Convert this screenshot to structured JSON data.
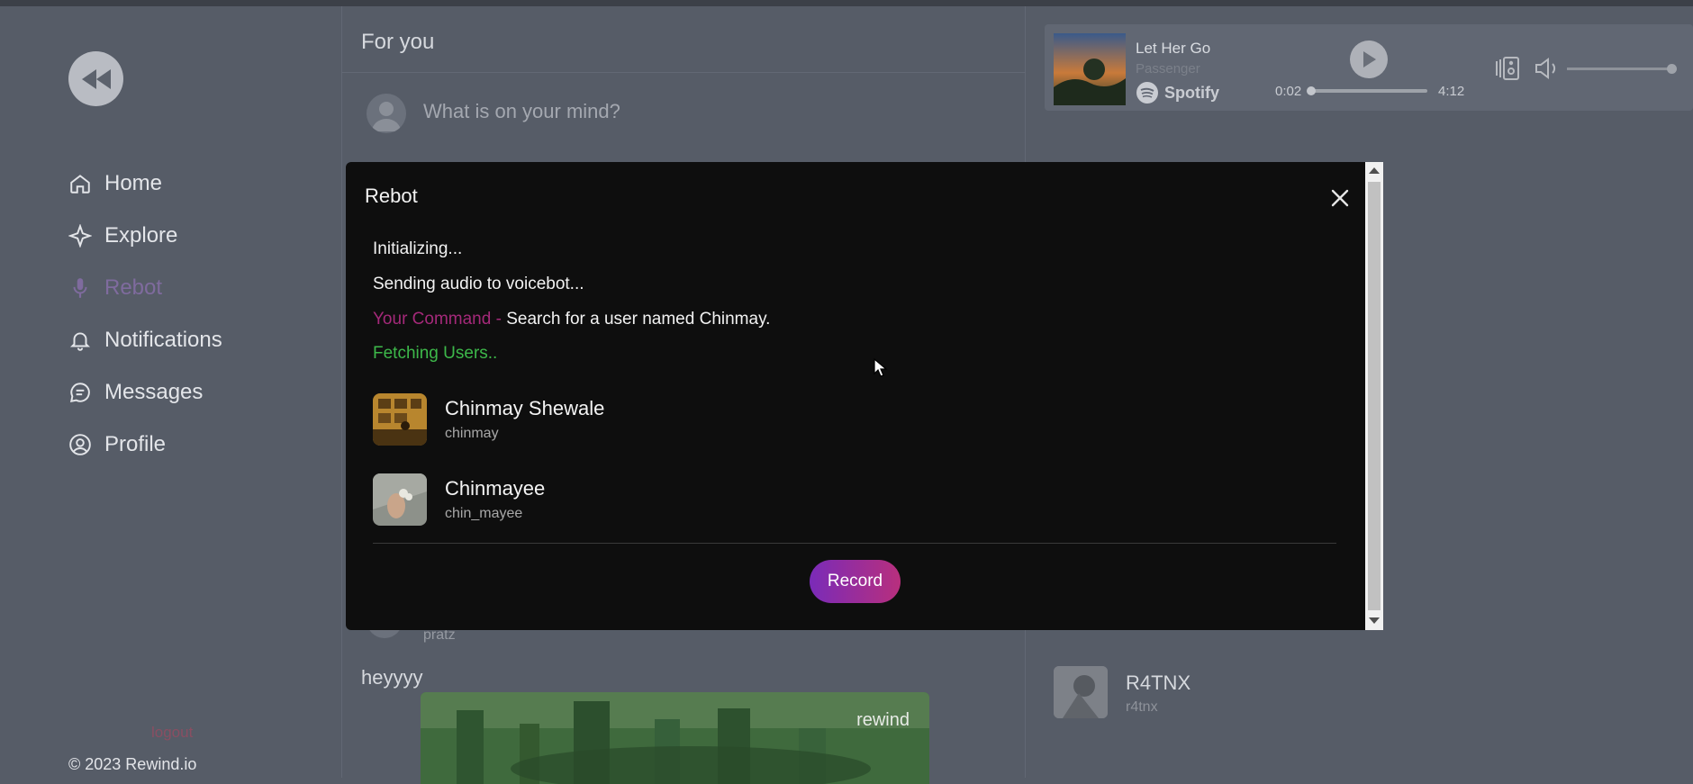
{
  "sidebar": {
    "items": [
      {
        "label": "Home",
        "icon": "home-icon"
      },
      {
        "label": "Explore",
        "icon": "sparkle-icon"
      },
      {
        "label": "Rebot",
        "icon": "microphone-icon",
        "active": true
      },
      {
        "label": "Notifications",
        "icon": "bell-icon"
      },
      {
        "label": "Messages",
        "icon": "message-icon"
      },
      {
        "label": "Profile",
        "icon": "user-circle-icon"
      }
    ],
    "logout": "logout",
    "copyright": "© 2023 Rewind.io"
  },
  "feed": {
    "title": "For you",
    "compose_placeholder": "What is on your mind?",
    "post": {
      "handle": "pratz",
      "text": "heyyyy",
      "image_label": "rewind"
    }
  },
  "player": {
    "track": "Let Her Go",
    "artist": "Passenger",
    "service": "Spotify",
    "elapsed": "0:02",
    "duration": "4:12",
    "progress_fraction": 0.008,
    "volume_fraction": 0.97
  },
  "suggestion": {
    "name": "R4TNX",
    "handle": "r4tnx"
  },
  "modal": {
    "title": "Rebot",
    "log": {
      "init": "Initializing...",
      "sending": "Sending audio to voicebot...",
      "command_label": "Your Command - ",
      "command_text": "Search for a user named Chinmay.",
      "fetching": "Fetching Users.."
    },
    "users": [
      {
        "name": "Chinmay Shewale",
        "handle": "chinmay"
      },
      {
        "name": "Chinmayee",
        "handle": "chin_mayee"
      }
    ],
    "record_label": "Record"
  },
  "colors": {
    "accent": "#7f6b9e",
    "command": "#a5297a",
    "fetch": "#3db84a",
    "record_start": "#7a2bb8",
    "record_end": "#b82f7d"
  }
}
